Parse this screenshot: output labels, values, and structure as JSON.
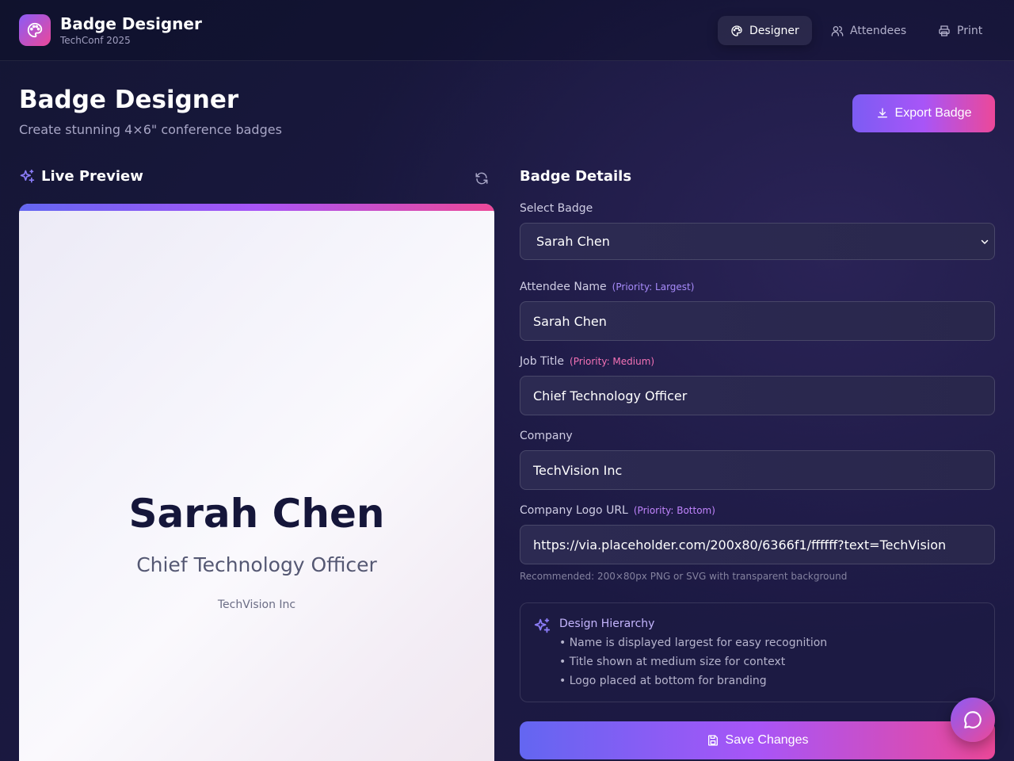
{
  "app": {
    "title": "Badge Designer",
    "subtitle": "TechConf 2025",
    "logo_icon": "palette-icon"
  },
  "nav": [
    {
      "label": "Designer",
      "icon": "palette-icon",
      "active": true
    },
    {
      "label": "Attendees",
      "icon": "users-icon",
      "active": false
    },
    {
      "label": "Print",
      "icon": "printer-icon",
      "active": false
    }
  ],
  "header": {
    "title": "Badge Designer",
    "subtitle": "Create stunning 4×6\" conference badges",
    "export_label": "Export Badge"
  },
  "preview": {
    "title": "Live Preview",
    "badge": {
      "name": "Sarah Chen",
      "job_title": "Chief Technology Officer",
      "company": "TechVision Inc"
    }
  },
  "form": {
    "title": "Badge Details",
    "select_label": "Select Badge",
    "select_value": "Sarah Chen",
    "name_label": "Attendee Name",
    "name_priority": "(Priority: Largest)",
    "name_value": "Sarah Chen",
    "job_label": "Job Title",
    "job_priority": "(Priority: Medium)",
    "job_value": "Chief Technology Officer",
    "company_label": "Company",
    "company_value": "TechVision Inc",
    "logo_label": "Company Logo URL",
    "logo_priority": "(Priority: Bottom)",
    "logo_value": "https://via.placeholder.com/200x80/6366f1/ffffff?text=TechVision",
    "logo_hint": "Recommended: 200×80px PNG or SVG with transparent background",
    "hierarchy": {
      "title": "Design Hierarchy",
      "items": [
        "• Name is displayed largest for easy recognition",
        "• Title shown at medium size for context",
        "• Logo placed at bottom for branding"
      ]
    },
    "save_label": "Save Changes"
  },
  "colors": {
    "accent_start": "#6366f1",
    "accent_mid": "#a855f7",
    "accent_end": "#ec4899",
    "background": "#16173a"
  }
}
